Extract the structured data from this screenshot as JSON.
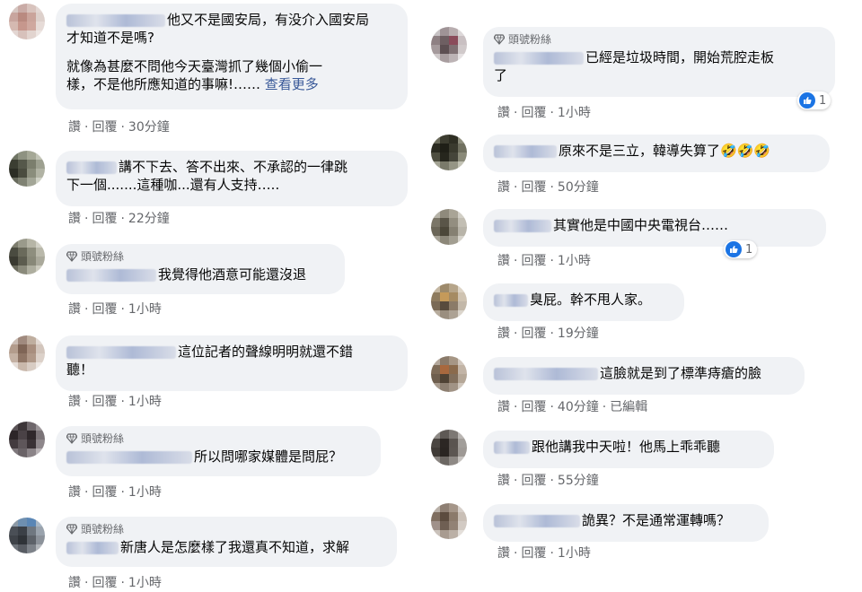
{
  "badge_label": "頭號粉絲",
  "actions": {
    "like": "讚",
    "reply": "回覆",
    "edited": "已編輯"
  },
  "more_label": "查看更多",
  "left_comments": [
    {
      "text1": "他又不是國安局，有没介入國安局",
      "text2": "才知道不是嗎?",
      "para2a": "就像為甚麼不問他今天臺灣抓了幾個小偷一",
      "para2b": "樣，不是他所應知道的事嘛!……",
      "time": "30分鐘"
    },
    {
      "text1": "講不下去、答不出來、不承認的一律跳",
      "text2": "下一個.......這種咖...還有人支持…..",
      "time": "22分鐘"
    },
    {
      "text1": "我覺得他酒意可能還沒退",
      "time": "1小時"
    },
    {
      "text1": "這位記者的聲線明明就還不錯",
      "text2": "聽！",
      "time": "1小時"
    },
    {
      "text1": "所以問哪家媒體是問屁？",
      "time": "1小時"
    },
    {
      "text1": "新唐人是怎麼樣了我還真不知道，求解",
      "time": "1小時"
    }
  ],
  "right_comments": [
    {
      "text1": "已經是垃圾時間，開始荒腔走板",
      "text2": "了",
      "time": "1小時",
      "reactions": "1"
    },
    {
      "text1": "原來不是三立，韓導失算了🤣🤣🤣",
      "time": "50分鐘"
    },
    {
      "text1": "其實他是中國中央電視台……",
      "time": "1小時",
      "reactions": "1"
    },
    {
      "text1": "臭屁。幹不甩人家。",
      "time": "19分鐘"
    },
    {
      "text1": "這臉就是到了標準痔瘡的臉",
      "time": "40分鐘"
    },
    {
      "text1": "跟他講我中天啦！他馬上乖乖聽",
      "time": "55分鐘"
    },
    {
      "text1": "詭異？不是通常運轉嗎？",
      "time": "1小時"
    }
  ]
}
